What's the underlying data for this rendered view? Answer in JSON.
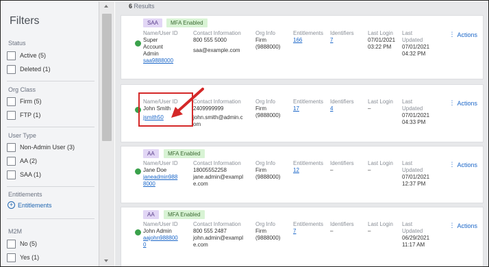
{
  "sidebar": {
    "title": "Filters",
    "sections": {
      "status": {
        "label": "Status",
        "options": [
          "Active (5)",
          "Deleted (1)"
        ]
      },
      "org_class": {
        "label": "Org Class",
        "options": [
          "Firm (5)",
          "FTP (1)"
        ]
      },
      "user_type": {
        "label": "User Type",
        "options": [
          "Non-Admin User (3)",
          "AA (2)",
          "SAA (1)"
        ]
      },
      "entitlements": {
        "label": "Entitlements",
        "link": "Entitlements"
      },
      "m2m": {
        "label": "M2M",
        "options": [
          "No (5)",
          "Yes (1)"
        ]
      }
    }
  },
  "results": {
    "count": "6",
    "label": "Results"
  },
  "columns": {
    "name": "Name/User ID",
    "contact": "Contact Information",
    "org": "Org Info",
    "entitlements": "Entitlements",
    "identifiers": "Identifiers",
    "last_login": "Last Login",
    "last_updated_1": "Last",
    "last_updated_2": "Updated"
  },
  "actions_label": "Actions",
  "cards": [
    {
      "role": "SAA",
      "mfa": "MFA Enabled",
      "name": [
        "Super",
        "Account",
        "Admin"
      ],
      "user_id": [
        "saa9888000"
      ],
      "contact": [
        "800 555 5000",
        "",
        "saa@example.com"
      ],
      "org": [
        "Firm",
        "(9888000)"
      ],
      "entitlements": "166",
      "identifiers": "7",
      "last_login": [
        "07/01/2021",
        "03:22 PM"
      ],
      "last_updated": [
        "07/01/2021",
        "04:32 PM"
      ]
    },
    {
      "role": "",
      "mfa": "",
      "name": [
        "John Smith"
      ],
      "user_id": [
        "jsmith50"
      ],
      "contact": [
        "2409999999",
        "",
        "john.smith@admin.c",
        "om"
      ],
      "org": [
        "Firm",
        "(9888000)"
      ],
      "entitlements": "17",
      "identifiers": "4",
      "last_login": [
        "–"
      ],
      "last_updated": [
        "07/01/2021",
        "04:33 PM"
      ]
    },
    {
      "role": "AA",
      "mfa": "MFA Enabled",
      "name": [
        "Jane Doe"
      ],
      "user_id": [
        "janeadmin988",
        "8000"
      ],
      "contact": [
        "18005552258",
        "jane.admin@exampl",
        "e.com"
      ],
      "org": [
        "Firm",
        "(9888000)"
      ],
      "entitlements": "12",
      "identifiers": "–",
      "last_login": [
        "–"
      ],
      "last_updated": [
        "07/01/2021",
        "12:37 PM"
      ]
    },
    {
      "role": "AA",
      "mfa": "MFA Enabled",
      "name": [
        "John Admin"
      ],
      "user_id": [
        "aajohn988800",
        "0"
      ],
      "contact": [
        "800 555 2487",
        "john.admin@exampl",
        "e.com"
      ],
      "org": [
        "Firm",
        "(9888000)"
      ],
      "entitlements": "7",
      "identifiers": "–",
      "last_login": [
        "–"
      ],
      "last_updated": [
        "06/29/2021",
        "11:17 AM"
      ]
    }
  ],
  "colors": {
    "accent": "#1a66c8",
    "status_active": "#3aa14b",
    "highlight": "#d42828",
    "role_tag": "#e2d6f5",
    "mfa_tag": "#d8f3d4"
  }
}
